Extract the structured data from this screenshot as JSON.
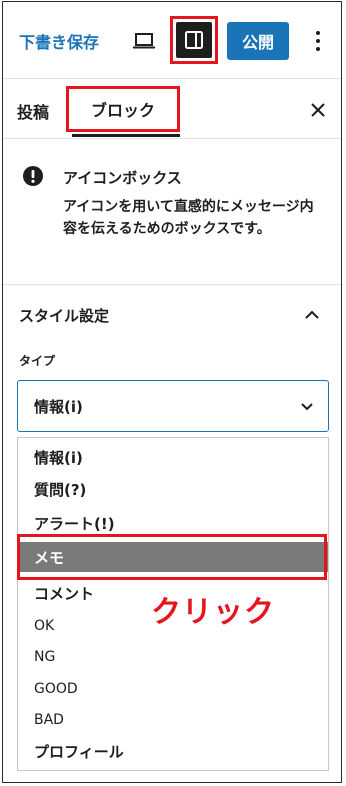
{
  "toolbar": {
    "save_draft": "下書き保存",
    "publish": "公開",
    "icons": [
      "preview-icon",
      "sidebar-toggle-icon",
      "more-options-icon"
    ]
  },
  "tabs": {
    "post": "投稿",
    "block": "ブロック"
  },
  "block_info": {
    "title": "アイコンボックス",
    "description": "アイコンを用いて直感的にメッセージ内容を伝えるためのボックスです。"
  },
  "style_settings": {
    "heading": "スタイル設定",
    "type_label": "タイプ",
    "selected_value": "情報(i)",
    "options": [
      {
        "label": "情報(i)"
      },
      {
        "label": "質問(?)"
      },
      {
        "label": "アラート(!)"
      },
      {
        "label": "メモ",
        "highlighted": true
      },
      {
        "label": "コメント"
      },
      {
        "label": "OK"
      },
      {
        "label": "NG"
      },
      {
        "label": "GOOD"
      },
      {
        "label": "BAD"
      },
      {
        "label": "プロフィール"
      }
    ]
  },
  "annotation": {
    "text": "クリック",
    "color": "#e3151e"
  },
  "colors": {
    "accent": "#1a74b8",
    "highlight_border": "#e3151e",
    "selected_item_bg": "#7a7a7a"
  }
}
